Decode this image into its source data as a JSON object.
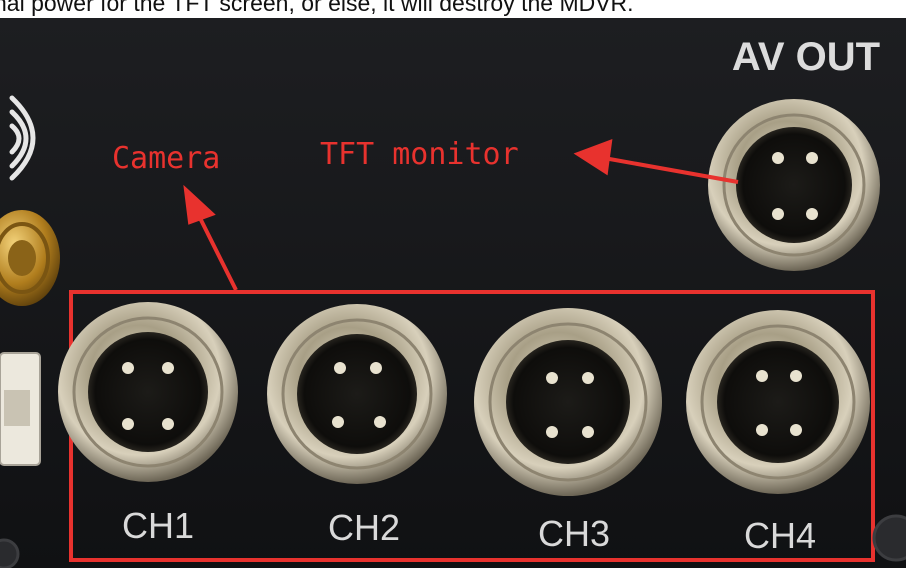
{
  "caption": "nal power for the TFT screen, or else, it will destroy the MDVR.",
  "labels": {
    "av_out": "AV OUT",
    "camera": "Camera",
    "tft_monitor": "TFT monitor"
  },
  "channels": [
    "CH1",
    "CH2",
    "CH3",
    "CH4"
  ],
  "colors": {
    "annotation": "#e8322e",
    "panel": "#17181a",
    "silkscreen": "#d9d9d9"
  }
}
